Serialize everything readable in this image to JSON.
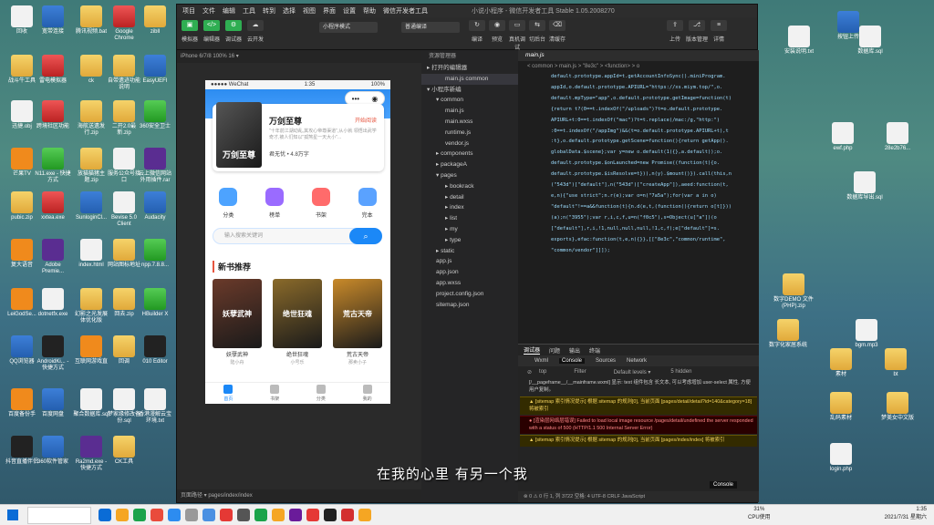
{
  "desktop_icons": [
    {
      "label": "回收",
      "style": "g-file"
    },
    {
      "label": "宽带连接",
      "style": "g-app"
    },
    {
      "label": "腾讯视频.bat",
      "style": "g-folder"
    },
    {
      "label": "Google Chrome",
      "style": "g-red"
    },
    {
      "label": "zibll",
      "style": "g-folder"
    },
    {
      "label": "战斗牛工具",
      "style": "g-folder"
    },
    {
      "label": "雷电模拟器",
      "style": "g-red"
    },
    {
      "label": "ck",
      "style": "g-folder"
    },
    {
      "label": "自带遗迹功能说明",
      "style": "g-folder"
    },
    {
      "label": "EasyUEFI",
      "style": "g-app"
    },
    {
      "label": "迅捷.obj",
      "style": "g-file"
    },
    {
      "label": "跨境社区功能",
      "style": "g-red"
    },
    {
      "label": "海航送遗发行.zip",
      "style": "g-folder"
    },
    {
      "label": "二开2.0最新.zip",
      "style": "g-folder"
    },
    {
      "label": "360安全卫士",
      "style": "g-green"
    },
    {
      "label": "芒果TV",
      "style": "g-orange"
    },
    {
      "label": "N11.exe - 快捷方式",
      "style": "g-green"
    },
    {
      "label": "放猫猫猪主题.zip",
      "style": "g-folder"
    },
    {
      "label": "服务公众号接口",
      "style": "g-file"
    },
    {
      "label": "云上微信网站外用插件.rar",
      "style": "g-purple"
    },
    {
      "label": "pubic.zip",
      "style": "g-folder"
    },
    {
      "label": "xxtea.exe",
      "style": "g-red"
    },
    {
      "label": "SunloginCl...",
      "style": "g-app"
    },
    {
      "label": "Bevise 5.0 Client",
      "style": "g-file"
    },
    {
      "label": "Audacity",
      "style": "g-app"
    },
    {
      "label": "复大语音",
      "style": "g-orange"
    },
    {
      "label": "Adobe Premie...",
      "style": "g-purple"
    },
    {
      "label": "index.html",
      "style": "g-file"
    },
    {
      "label": "网站图标地址",
      "style": "g-folder"
    },
    {
      "label": "npp.7.8.8...",
      "style": "g-green"
    },
    {
      "label": "LeiGodSe...",
      "style": "g-orange"
    },
    {
      "label": "dotnetfx.exe",
      "style": "g-file"
    },
    {
      "label": "幻影之光发展体优化版",
      "style": "g-folder"
    },
    {
      "label": "回去.zip",
      "style": "g-folder"
    },
    {
      "label": "HBuilder X",
      "style": "g-green"
    },
    {
      "label": "QQ浏览器",
      "style": "g-app"
    },
    {
      "label": "AndroidKi... - 快捷方式",
      "style": "g-dark"
    },
    {
      "label": "互联网游戏直",
      "style": "g-orange"
    },
    {
      "label": "回调",
      "style": "g-folder"
    },
    {
      "label": "010 Editor",
      "style": "g-dark"
    },
    {
      "label": "百度备份手",
      "style": "g-orange"
    },
    {
      "label": "百度网盘",
      "style": "g-app"
    },
    {
      "label": "聚合数据库.sql",
      "style": "g-file"
    },
    {
      "label": "梦家缘修改备份.sql",
      "style": "g-file"
    },
    {
      "label": "香港漫解云宝环境.txt",
      "style": "g-file"
    },
    {
      "label": "抖音直播伴侣",
      "style": "g-dark"
    },
    {
      "label": "360软件管家",
      "style": "g-app"
    },
    {
      "label": "Ra2md.exe - 快捷方式",
      "style": "g-purple"
    },
    {
      "label": "CK工具",
      "style": "g-folder"
    }
  ],
  "desktop_icons_right": [
    {
      "label": "按钮上传",
      "style": "g-app"
    },
    {
      "label": "安装说明.txt",
      "style": "g-file"
    },
    {
      "label": "数据库.sql",
      "style": "g-file"
    },
    {
      "label": "ewf.php",
      "style": "g-file"
    },
    {
      "label": "28e2b76...",
      "style": "g-file"
    },
    {
      "label": "数据库导出.sql",
      "style": "g-file"
    },
    {
      "label": "数字DEMO 文件(PHP).zip",
      "style": "g-folder"
    },
    {
      "label": "数字化家居系统",
      "style": "g-folder"
    },
    {
      "label": "bgm.mp3",
      "style": "g-file"
    },
    {
      "label": "素材",
      "style": "g-folder"
    },
    {
      "label": "bt",
      "style": "g-folder"
    },
    {
      "label": "乱码素材",
      "style": "g-folder"
    },
    {
      "label": "梦美女中文版",
      "style": "g-folder"
    },
    {
      "label": "login.php",
      "style": "g-file"
    }
  ],
  "window": {
    "menu": [
      "项目",
      "文件",
      "编辑",
      "工具",
      "转到",
      "选择",
      "视图",
      "界面",
      "设置",
      "帮助",
      "微信开发者工具"
    ],
    "title": "小说小程序 - 微信开发者工具 Stable 1.05.2008270",
    "toolbar_left": [
      {
        "label": "模拟器",
        "icon": "▣"
      },
      {
        "label": "编辑器",
        "icon": "</>"
      },
      {
        "label": "调试器",
        "icon": "⚙"
      },
      {
        "label": "云开发",
        "icon": "☁"
      }
    ],
    "mode_select": "小程序模式",
    "compile_select": "普通编译",
    "toolbar_mid": [
      {
        "label": "编译",
        "icon": "↻"
      },
      {
        "label": "预览",
        "icon": "◉"
      },
      {
        "label": "真机调试",
        "icon": "▭"
      },
      {
        "label": "切后台",
        "icon": "⇆"
      },
      {
        "label": "清缓存",
        "icon": "⌫"
      }
    ],
    "toolbar_right": [
      {
        "label": "上传",
        "icon": "⇪"
      },
      {
        "label": "版本管理",
        "icon": "⎇"
      },
      {
        "label": "详情",
        "icon": "≡"
      }
    ]
  },
  "simulator": {
    "device": "iPhone 6/7/8 100% 16 ▾",
    "status_left": "●●●●● WeChat",
    "status_time": "1:35",
    "status_right": "100%",
    "banner": {
      "cover": "万剑至尊",
      "title": "万剑至尊",
      "read": "开始阅读",
      "desc": "\"十年前江湖动乱,其攻心帝尊渠道\",从小就 领悟出武学奇才,被人们知以\"孤煞星一天大小\"...",
      "author": "君无忧  •  4.8万字"
    },
    "categories": [
      {
        "label": "分类",
        "color": "#4da3ff"
      },
      {
        "label": "榜单",
        "color": "#9a6bff"
      },
      {
        "label": "书架",
        "color": "#ff6b6b"
      },
      {
        "label": "完本",
        "color": "#5aa2ff"
      }
    ],
    "search_placeholder": "输入搜索关键词",
    "section_title": "新书推荐",
    "books": [
      {
        "cover": "妖孽武神",
        "title": "妖孽武神",
        "author": "陆小舟",
        "color": "#6a3a2a"
      },
      {
        "cover": "绝世狂魂",
        "title": "绝世狂魂",
        "author": "小号乐",
        "color": "#8a6a2a"
      },
      {
        "cover": "荒古天帝",
        "title": "荒古天帝",
        "author": "那卖小子",
        "color": "#c98a2a"
      }
    ],
    "tabs": [
      {
        "label": "首页",
        "active": true
      },
      {
        "label": "书架",
        "active": false
      },
      {
        "label": "分类",
        "active": false
      },
      {
        "label": "我的",
        "active": false
      }
    ],
    "footer": "页面路径 ▾    pages/index/index"
  },
  "explorer": {
    "header": "资源管理器",
    "items": [
      {
        "text": "▸ 打开的编辑器",
        "indent": 0,
        "sel": false
      },
      {
        "text": "main.js  common",
        "indent": 2,
        "sel": true
      },
      {
        "text": "▾ 小程序新编",
        "indent": 0,
        "sel": false
      },
      {
        "text": "▾ common",
        "indent": 1,
        "sel": false
      },
      {
        "text": "main.js",
        "indent": 2,
        "sel": false
      },
      {
        "text": "main.wxss",
        "indent": 2,
        "sel": false
      },
      {
        "text": "runtime.js",
        "indent": 2,
        "sel": false
      },
      {
        "text": "vendor.js",
        "indent": 2,
        "sel": false
      },
      {
        "text": "▸ components",
        "indent": 1,
        "sel": false
      },
      {
        "text": "▸ packageA",
        "indent": 1,
        "sel": false
      },
      {
        "text": "▾ pages",
        "indent": 1,
        "sel": false
      },
      {
        "text": "▸ bookrack",
        "indent": 2,
        "sel": false
      },
      {
        "text": "▸ detail",
        "indent": 2,
        "sel": false
      },
      {
        "text": "▸ index",
        "indent": 2,
        "sel": false
      },
      {
        "text": "▸ list",
        "indent": 2,
        "sel": false
      },
      {
        "text": "▸ my",
        "indent": 2,
        "sel": false
      },
      {
        "text": "▸ type",
        "indent": 2,
        "sel": false
      },
      {
        "text": "▸ static",
        "indent": 1,
        "sel": false
      },
      {
        "text": "app.js",
        "indent": 1,
        "sel": false
      },
      {
        "text": "app.json",
        "indent": 1,
        "sel": false
      },
      {
        "text": "app.wxss",
        "indent": 1,
        "sel": false
      },
      {
        "text": "project.config.json",
        "indent": 1,
        "sel": false
      },
      {
        "text": "sitemap.json",
        "indent": 1,
        "sel": false
      }
    ]
  },
  "editor": {
    "tab": "main.js",
    "breadcrumb": "< common > main.js > \"8e3c\" > <function> > o",
    "code": [
      "default.prototype.appId=t.getAccountInfoSync().miniProgram.",
      "appId,o.default.prototype.APIURL=\"https://xs.miym.top/\",o.",
      "default.mpType=\"app\",o.default.prototype.getImage=function(t)",
      "{return t?(0==t.indexOf(\"/uploads\")?t=o.default.prototype.",
      "APIURL+t:0==t.indexOf(\"mac\")?t=t.replace(/mac:/g,\"http:\")",
      ":0==t.indexOf(\"/appImg\")&&(t=o.default.prototype.APIURL+t),t",
      ":t},o.default.prototype.getScene=function(){return getApp().",
      "globalData.$scene};var y=new o.default(1({},a.default));o.",
      "default.prototype.$onLaunched=new Promise((function(t){o.",
      "default.prototype.$isResolve=t})),n(y).$mount()}).call(this,n",
      "(\"543d\")[\"default\"],n(\"543d\")[\"createApp\"]),aeed:function(t,",
      "e,n){\"use strict\";n.r(e);var o=n(\"7a5a\");for(var a in o)",
      "\"default\"!==a&&function(t){n.d(e,t,(function(){return o[t]}))",
      "(a);n(\"3955\");var r,i,c,f,u=n(\"f0c5\"),s=Object(u[\"a\"])(o",
      "[\"default\"],r,i,!1,null,null,null,!1,c,f);e[\"default\"]=s.",
      "exports},efac:function(t,e,n){}},[[\"8e3c\",\"common/runtime\",",
      "\"common/vendor\"]]]);"
    ]
  },
  "console": {
    "tabs": [
      "调试器",
      "问题",
      "输出",
      "终端"
    ],
    "subtabs": [
      "Wxml",
      "Console",
      "Sources",
      "Network"
    ],
    "filter_context": "top",
    "filter_placeholder": "Filter",
    "filter_levels": "Default levels ▾",
    "hidden_count": "5 hidden",
    "messages": [
      {
        "type": "plain",
        "text": "[/__pageframe__/__mainframe.wxml] 显示: text 组件包含 长文本, 可以考虑增加 user-select 属性, 方便用户复制。"
      },
      {
        "type": "warn",
        "text": "▲ [sitemap 索引情况提示] 根据 sitemap 的规则[0], 当前页面 [pages/detail/detail?id=140&category=18] 将被索引"
      },
      {
        "type": "err",
        "text": "● [渲染层网络层错误] Failed to load local image resource /pages/detail/undefined the server responded with a status of 500 (HTTP/1.1 500 Internal Server Error)"
      },
      {
        "type": "warn",
        "text": "▲ [sitemap 索引情况提示] 根据 sitemap 的规则[0], 当前页面 [pages/index/index] 将被索引"
      }
    ],
    "drawer": "Console"
  },
  "statusbar": "⊗ 0 ⚠ 0      行 1, 列 3722  空格: 4  UTF-8  CRLF  JavaScript",
  "caption": "在我的心里 有另一个我",
  "taskbar": {
    "cpu_pct": "31%",
    "cpu_label": "CPU使用",
    "time": "1:35",
    "date": "2021/7/31 星期六"
  }
}
